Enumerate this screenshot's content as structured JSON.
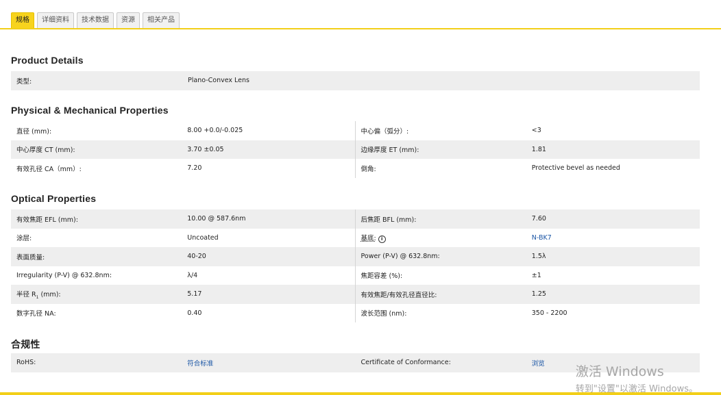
{
  "tabs": [
    "规格",
    "详细资料",
    "技术数据",
    "资源",
    "相关产品"
  ],
  "product_details": {
    "title": "Product Details",
    "rows": [
      {
        "label": "类型:",
        "value": "Plano-Convex Lens"
      }
    ]
  },
  "physical": {
    "title": "Physical & Mechanical Properties",
    "rows": [
      {
        "l1": "直径 (mm):",
        "v1": "8.00 +0.0/-0.025",
        "l2": "中心偏（弧分）:",
        "v2": "<3"
      },
      {
        "l1": "中心厚度 CT (mm):",
        "v1": "3.70 ±0.05",
        "l2": "边缘厚度 ET (mm):",
        "v2": "1.81"
      },
      {
        "l1": "有效孔径 CA（mm）:",
        "v1": "7.20",
        "l2": "倒角:",
        "v2": "Protective bevel as needed"
      }
    ]
  },
  "optical": {
    "title": "Optical Properties",
    "rows": [
      {
        "l1": "有效焦距 EFL (mm):",
        "v1": "10.00 @ 587.6nm",
        "l2": "后焦距 BFL (mm):",
        "v2": "7.60"
      },
      {
        "l1": "涂层:",
        "v1": "Uncoated",
        "l2": "基底:",
        "v2": "N-BK7"
      },
      {
        "l1": "表面质量:",
        "v1": "40-20",
        "l2": "Power (P-V) @ 632.8nm:",
        "v2": "1.5λ"
      },
      {
        "l1": "Irregularity (P-V) @ 632.8nm:",
        "v1": "λ/4",
        "l2": "焦距容差 (%):",
        "v2": "±1"
      },
      {
        "l1_main": "半径 R",
        "l1_sub": "1",
        "l1_tail": " (mm):",
        "v1": "5.17",
        "l2": "有效焦距/有效孔径直径比:",
        "v2": "1.25"
      },
      {
        "l1": "数字孔径 NA:",
        "v1": "0.40",
        "l2": "波长范围 (nm):",
        "v2": "350 - 2200"
      }
    ]
  },
  "compliance": {
    "title": "合规性",
    "row": {
      "l1": "RoHS:",
      "v1": "符合标准",
      "l2": "Certificate of Conformance:",
      "v2": "浏览"
    }
  },
  "info_icon_glyph": "i",
  "watermark": {
    "line1": "激活 Windows",
    "line2": "转到\"设置\"以激活 Windows。"
  }
}
